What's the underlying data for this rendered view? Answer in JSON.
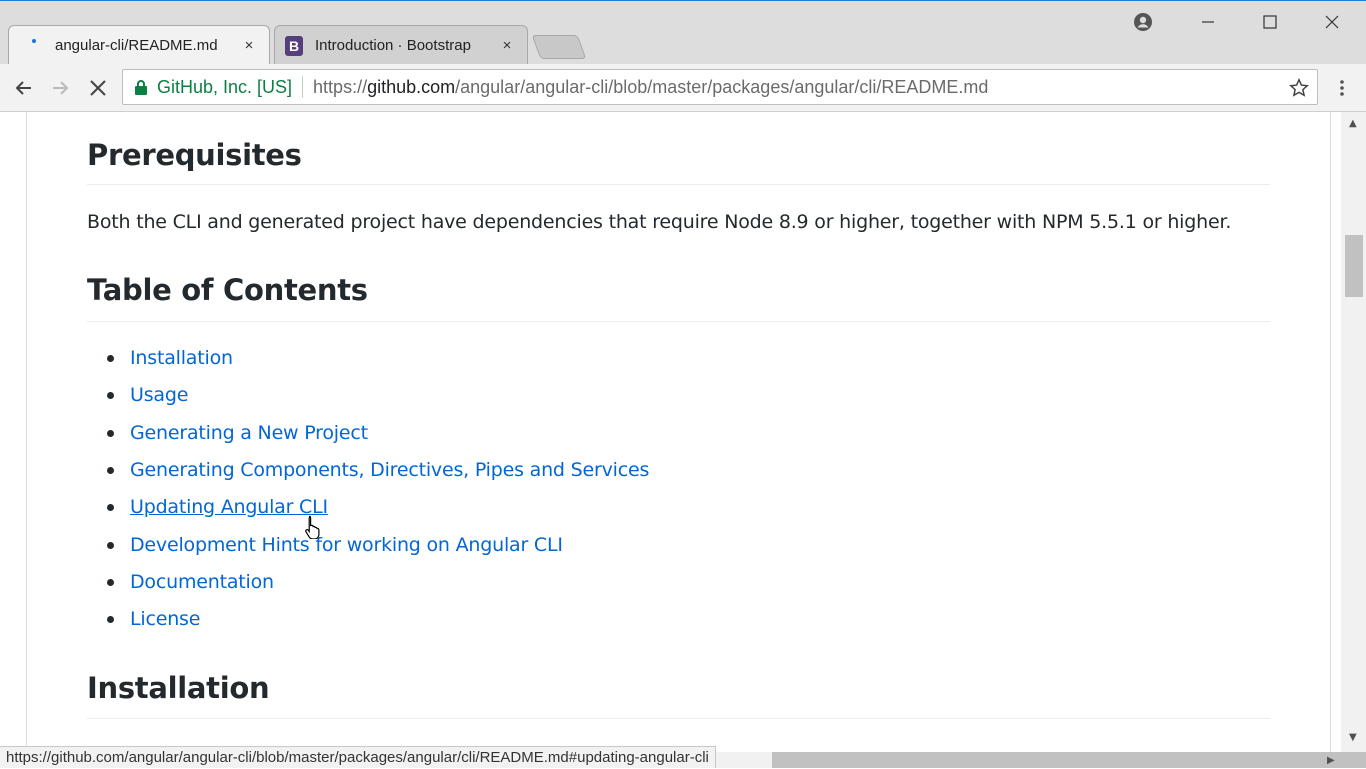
{
  "browser": {
    "tabs": [
      {
        "title": "angular-cli/README.md",
        "close": "×",
        "loading": true
      },
      {
        "title": "Introduction · Bootstrap",
        "favicon_letter": "B",
        "close": "×"
      }
    ],
    "address": {
      "secure_label": "GitHub, Inc. [US]",
      "scheme": "https://",
      "host": "github.com",
      "path": "/angular/angular-cli/blob/master/packages/angular/cli/README.md"
    },
    "status_url": "https://github.com/angular/angular-cli/blob/master/packages/angular/cli/README.md#updating-angular-cli"
  },
  "page": {
    "prerequisites_heading": "Prerequisites",
    "prerequisites_text": "Both the CLI and generated project have dependencies that require Node 8.9 or higher, together with NPM 5.5.1 or higher.",
    "toc_heading": "Table of Contents",
    "toc_items": [
      "Installation",
      "Usage",
      "Generating a New Project",
      "Generating Components, Directives, Pipes and Services",
      "Updating Angular CLI",
      "Development Hints for working on Angular CLI",
      "Documentation",
      "License"
    ],
    "installation_heading": "Installation"
  },
  "colors": {
    "link": "#0366d6",
    "text": "#24292e",
    "secure": "#0b8043",
    "bootstrap": "#563d7c"
  }
}
